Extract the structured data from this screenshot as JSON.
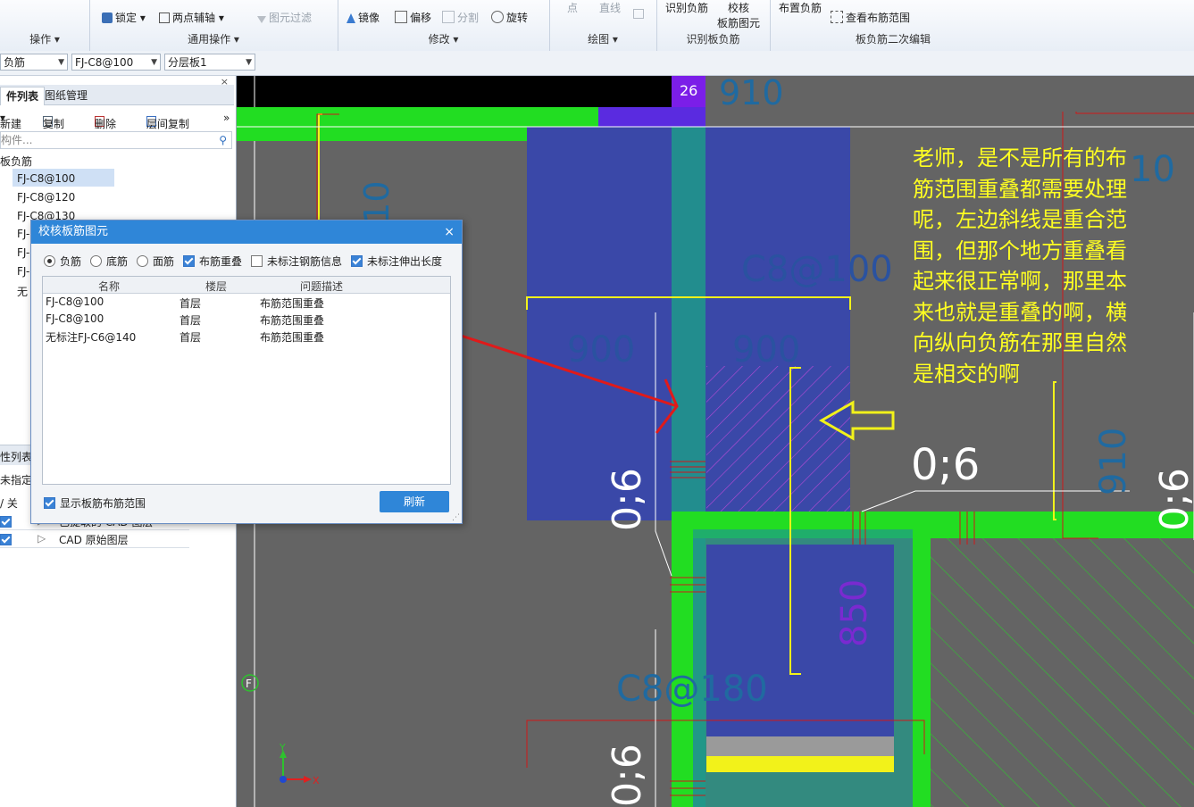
{
  "ribbon": {
    "lock": "锁定",
    "two_point_axis": "两点辅轴",
    "element_filter": "图元过滤",
    "mirror": "镜像",
    "offset": "偏移",
    "split": "分割",
    "rotate": "旋转",
    "point": "点",
    "line": "直线",
    "recognize_neg": "识别负筋",
    "check": "校核",
    "check2": "板筋图元",
    "place_neg": "布置负筋",
    "view_range": "查看布筋范围",
    "groups": {
      "operate": "操作",
      "common": "通用操作",
      "modify": "修改",
      "draw": "绘图",
      "recognize": "识别板负筋",
      "secondary": "板负筋二次编辑"
    }
  },
  "propbar": {
    "type": "负筋",
    "spec": "FJ-C8@100",
    "layer": "分层板1"
  },
  "left": {
    "tab1": "件列表",
    "tab2": "图纸管理",
    "new": "新建",
    "copy": "复制",
    "delete": "删除",
    "floor_copy": "层间复制",
    "search_placeholder": "构件...",
    "root": "板负筋",
    "items": [
      "FJ-C8@100",
      "FJ-C8@120",
      "FJ-C8@130",
      "FJ-",
      "FJ-",
      "FJ-",
      "无"
    ],
    "lower_tab": "性列表",
    "lower_row": "未指定图",
    "col_onoff": "/ 关",
    "layer_row1": "已提取的 CAD 图层",
    "layer_row2": "CAD 原始图层"
  },
  "dialog": {
    "title": "校核板筋图元",
    "close": "×",
    "opt_neg": "负筋",
    "opt_bottom": "底筋",
    "opt_top": "面筋",
    "chk_overlap": "布筋重叠",
    "chk_unlabeled": "未标注钢筋信息",
    "chk_extension": "未标注伸出长度",
    "col_name": "名称",
    "col_floor": "楼层",
    "col_desc": "问题描述",
    "rows": [
      {
        "name": "FJ-C8@100",
        "floor": "首层",
        "desc": "布筋范围重叠"
      },
      {
        "name": "FJ-C8@100",
        "floor": "首层",
        "desc": "布筋范围重叠"
      },
      {
        "name": "无标注FJ-C6@140",
        "floor": "首层",
        "desc": "布筋范围重叠"
      }
    ],
    "show_range": "显示板筋布筋范围",
    "refresh": "刷新"
  },
  "cad": {
    "label_26": "26",
    "dim_910_top": "910",
    "dim_900_a": "900",
    "dim_900_b": "900",
    "dim_850": "850",
    "dim_910_right": "910",
    "dim_10": "10",
    "text_c8100": "C8@100",
    "text_c8180": "C8@180",
    "label_06_a": "0;6",
    "label_06_b": "0;6",
    "label_06_c": "0;6",
    "label_06_d": "0;6",
    "axis_f": "F",
    "axis_x": "X",
    "axis_y": "Y",
    "question": "老师，是不是所有的布筋范围重叠都需要处理呢，左边斜线是重合范围，但那个地方重叠看起来很正常啊，那里本来也就是重叠的啊，横向纵向负筋在那里自然是相交的啊"
  }
}
